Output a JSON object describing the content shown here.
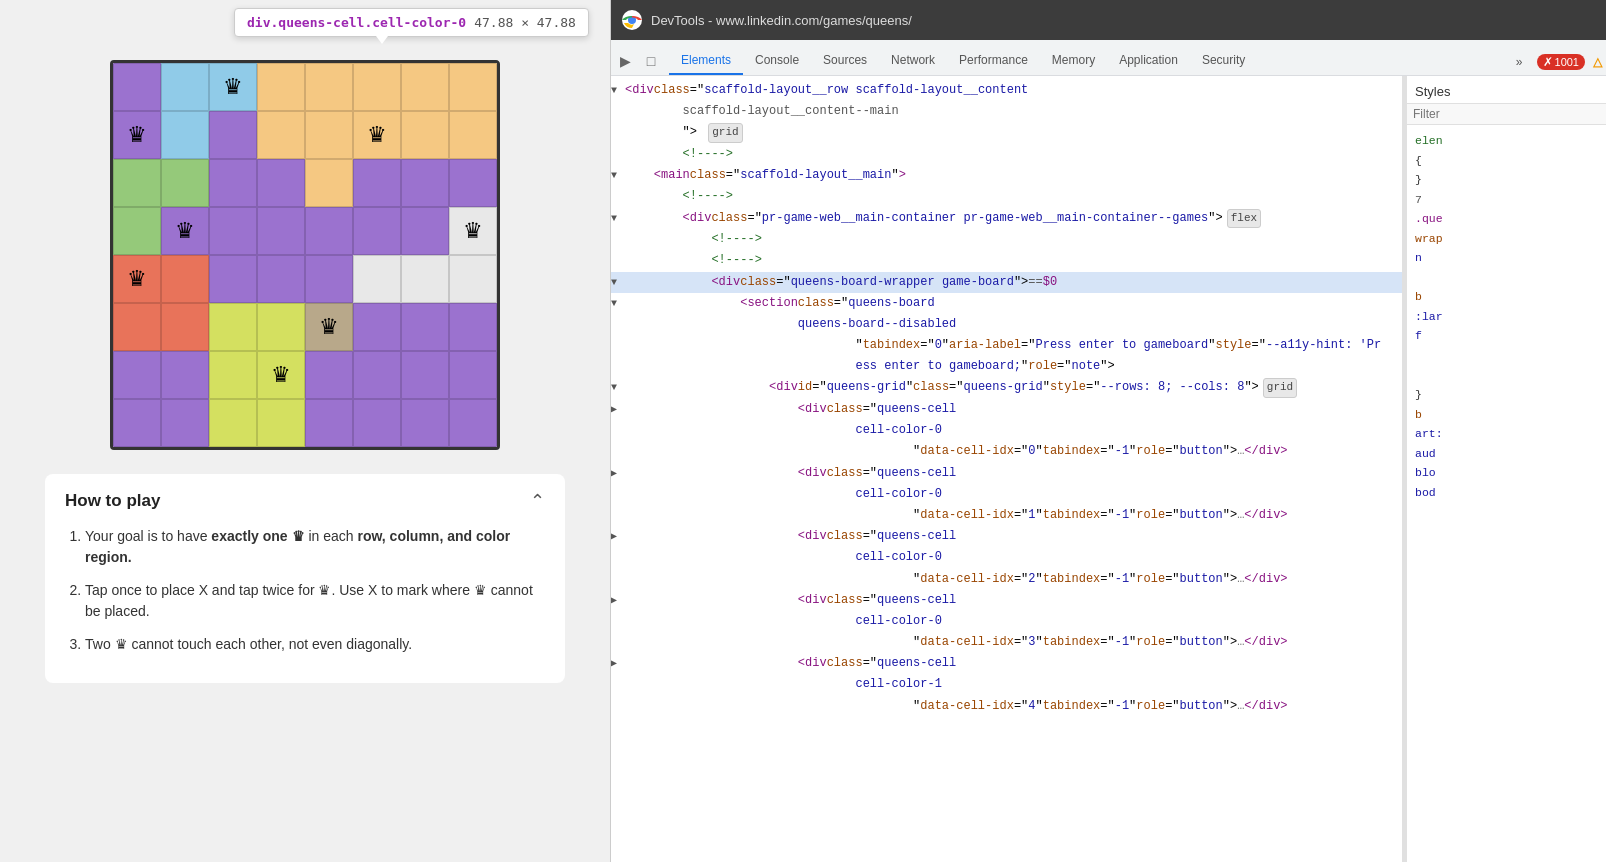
{
  "tooltip": {
    "class_name": "div.queens-cell.cell-color-0",
    "size": "47.88 × 47.88"
  },
  "game_board": {
    "grid_size": 8,
    "cells": [
      {
        "color": "purple",
        "has_crown": false
      },
      {
        "color": "lightblue",
        "has_crown": false
      },
      {
        "color": "lightblue",
        "has_crown": true
      },
      {
        "color": "orange",
        "has_crown": false
      },
      {
        "color": "orange",
        "has_crown": false
      },
      {
        "color": "orange",
        "has_crown": false
      },
      {
        "color": "orange",
        "has_crown": false
      },
      {
        "color": "orange",
        "has_crown": false
      },
      {
        "color": "purple",
        "has_crown": true
      },
      {
        "color": "lightblue",
        "has_crown": false
      },
      {
        "color": "purple",
        "has_crown": false
      },
      {
        "color": "orange",
        "has_crown": false
      },
      {
        "color": "orange",
        "has_crown": false
      },
      {
        "color": "orange",
        "has_crown": true
      },
      {
        "color": "orange",
        "has_crown": false
      },
      {
        "color": "orange",
        "has_crown": false
      },
      {
        "color": "green",
        "has_crown": false
      },
      {
        "color": "green",
        "has_crown": false
      },
      {
        "color": "purple",
        "has_crown": false
      },
      {
        "color": "purple",
        "has_crown": false
      },
      {
        "color": "orange",
        "has_crown": false
      },
      {
        "color": "purple",
        "has_crown": false
      },
      {
        "color": "purple",
        "has_crown": false
      },
      {
        "color": "purple",
        "has_crown": false
      },
      {
        "color": "green",
        "has_crown": false
      },
      {
        "color": "purple",
        "has_crown": true
      },
      {
        "color": "purple",
        "has_crown": false
      },
      {
        "color": "purple",
        "has_crown": false
      },
      {
        "color": "purple",
        "has_crown": false
      },
      {
        "color": "purple",
        "has_crown": false
      },
      {
        "color": "purple",
        "has_crown": false
      },
      {
        "color": "white",
        "has_crown": true
      },
      {
        "color": "orange_r",
        "has_crown": true
      },
      {
        "color": "orange_r",
        "has_crown": false
      },
      {
        "color": "purple",
        "has_crown": false
      },
      {
        "color": "purple",
        "has_crown": false
      },
      {
        "color": "purple",
        "has_crown": false
      },
      {
        "color": "white",
        "has_crown": false
      },
      {
        "color": "white",
        "has_crown": false
      },
      {
        "color": "white",
        "has_crown": false
      },
      {
        "color": "orange_r",
        "has_crown": false
      },
      {
        "color": "orange_r",
        "has_crown": false
      },
      {
        "color": "yellow",
        "has_crown": false
      },
      {
        "color": "yellow",
        "has_crown": false
      },
      {
        "color": "tan",
        "has_crown": true
      },
      {
        "color": "purple",
        "has_crown": false
      },
      {
        "color": "purple",
        "has_crown": false
      },
      {
        "color": "purple",
        "has_crown": false
      },
      {
        "color": "purple",
        "has_crown": false
      },
      {
        "color": "purple",
        "has_crown": false
      },
      {
        "color": "yellow",
        "has_crown": false
      },
      {
        "color": "yellow",
        "has_crown": true
      },
      {
        "color": "purple",
        "has_crown": false
      },
      {
        "color": "purple",
        "has_crown": false
      },
      {
        "color": "purple",
        "has_crown": false
      },
      {
        "color": "purple",
        "has_crown": false
      },
      {
        "color": "purple",
        "has_crown": false
      },
      {
        "color": "purple",
        "has_crown": false
      },
      {
        "color": "purple",
        "has_crown": false
      },
      {
        "color": "yellow",
        "has_crown": false
      },
      {
        "color": "yellow",
        "has_crown": false
      },
      {
        "color": "purple",
        "has_crown": false
      },
      {
        "color": "purple",
        "has_crown": false
      },
      {
        "color": "purple",
        "has_crown": false
      }
    ]
  },
  "how_to_play": {
    "title": "How to play",
    "rules": [
      "Your goal is to have exactly one 👑 in each row, column, and color region.",
      "Tap once to place X and tap twice for 👑. Use X to mark where 👑 cannot be placed.",
      "Two 👑 cannot touch each other, not even diagonally."
    ]
  },
  "devtools": {
    "title": "DevTools - www.linkedin.com/games/queens/",
    "tabs": [
      "Elements",
      "Console",
      "Sources",
      "Network",
      "Performance",
      "Memory",
      "Application",
      "Security"
    ],
    "active_tab": "Elements",
    "error_count": "1001",
    "warn_icon": "⚠",
    "html_content": [
      {
        "indent": 6,
        "expanded": true,
        "content": "<div class=\"scaffold-layout__row scaffold-layout__content scaffold-layout__content--main\""
      },
      {
        "indent": 8,
        "content": "\"> ",
        "badge": "grid"
      },
      {
        "indent": 8,
        "content": "<!---->"
      },
      {
        "indent": 8,
        "expanded": true,
        "content": "<main class=\"scaffold-layout__main\">"
      },
      {
        "indent": 10,
        "content": "<!---->"
      },
      {
        "indent": 10,
        "expanded": true,
        "content": "<div class=\"pr-game-web__main-container pr-game-web__main-container--games\">",
        "badge": "flex"
      },
      {
        "indent": 12,
        "content": "<!---->"
      },
      {
        "indent": 12,
        "content": "<!---->"
      },
      {
        "indent": 12,
        "expanded": true,
        "content": "<div class=\"queens-board-wrapper game-board\"> == $0",
        "selected": true
      },
      {
        "indent": 14,
        "expanded": true,
        "content": "<section class=\"queens-board"
      },
      {
        "indent": 16,
        "content": "queens-board--disabled"
      },
      {
        "indent": 18,
        "content": "\" tabindex=\"0\" aria-label=\"Press enter to gameboard\" style=\"--a11y-hint: 'Pr"
      },
      {
        "indent": 18,
        "content": "ess enter to gameboard;\" role=\"note\">"
      },
      {
        "indent": 16,
        "expanded": true,
        "content": "<div id=\"queens-grid\" class=\"queens-grid\" style=\"--rows: 8; --cols: 8\">",
        "badge": "grid"
      },
      {
        "indent": 18,
        "collapsed": true,
        "content": "<div class=\"queens-cell"
      },
      {
        "indent": 20,
        "content": "cell-color-0"
      },
      {
        "indent": 22,
        "content": "\" data-cell-idx=\"0\" tabindex=\"-1\" role=\"button\">"
      },
      {
        "indent": 24,
        "content": "… </div>"
      },
      {
        "indent": 18,
        "collapsed": true,
        "content": "<div class=\"queens-cell"
      },
      {
        "indent": 20,
        "content": "cell-color-0"
      },
      {
        "indent": 22,
        "content": "\" data-cell-idx=\"1\" tabindex=\"-1\" role=\"button\">"
      },
      {
        "indent": 24,
        "content": "… </div>"
      },
      {
        "indent": 18,
        "collapsed": true,
        "content": "<div class=\"queens-cell"
      },
      {
        "indent": 20,
        "content": "cell-color-0"
      },
      {
        "indent": 22,
        "content": "\" data-cell-idx=\"2\" tabindex=\"-1\" role=\"button\">"
      },
      {
        "indent": 24,
        "content": "… </div>"
      },
      {
        "indent": 18,
        "collapsed": true,
        "content": "<div class=\"queens-cell"
      },
      {
        "indent": 20,
        "content": "cell-color-0"
      },
      {
        "indent": 22,
        "content": "\" data-cell-idx=\"3\" tabindex=\"-1\" role=\"button\">"
      },
      {
        "indent": 24,
        "content": "… </div>"
      },
      {
        "indent": 18,
        "collapsed": true,
        "content": "<div class=\"queens-cell"
      },
      {
        "indent": 20,
        "content": "cell-color-1"
      },
      {
        "indent": 22,
        "content": "\" data-cell-idx=\"4\" tabindex=\"-1\" role=\"button\">"
      },
      {
        "indent": 24,
        "content": "… </div>"
      }
    ],
    "styles_panel": {
      "title": "Styl",
      "filter_placeholder": "Filter",
      "lines": [
        "elen",
        "{",
        "}",
        "7",
        ".que",
        "wrap",
        "n",
        "",
        "b",
        ":lar",
        "f",
        "",
        "",
        "",
        "",
        "",
        "}",
        "b",
        "art:",
        "aud",
        "blo",
        "bod"
      ]
    }
  },
  "colors": {
    "purple": "#9b72cf",
    "lightblue": "#90cbe8",
    "orange": "#f5c882",
    "green": "#95c97a",
    "white": "#e8e8e8",
    "orange_r": "#e8735a",
    "yellow": "#d4e060",
    "tan": "#b8a88a",
    "devtools_selected": "#d6e4f7",
    "devtools_bg": "#ffffff",
    "tag_color": "#881280",
    "attr_color": "#994500",
    "val_color": "#1a1aa6"
  }
}
